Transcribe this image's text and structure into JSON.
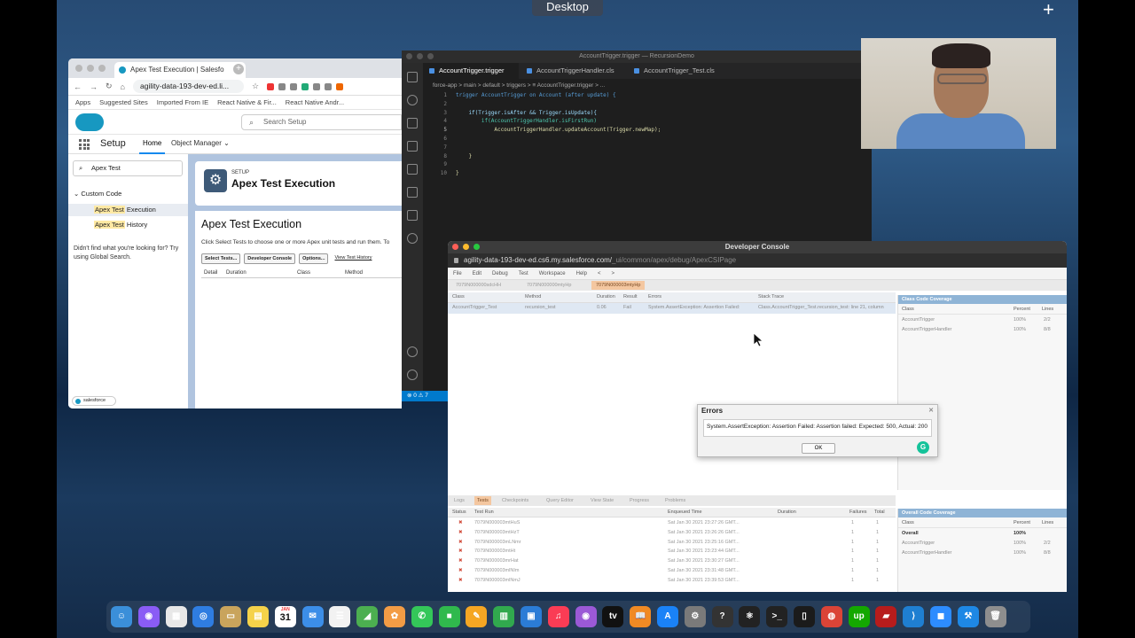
{
  "desktop": {
    "label": "Desktop"
  },
  "browser": {
    "tab_title": "Apex Test Execution | Salesfo",
    "url": "agility-data-193-dev-ed.li...",
    "bookmarks": [
      "Apps",
      "Suggested Sites",
      "Imported From IE",
      "React Native & Fir...",
      "React Native Andr..."
    ]
  },
  "salesforce": {
    "search_placeholder": "Search Setup",
    "app_name": "Setup",
    "nav": {
      "home": "Home",
      "object_manager": "Object Manager"
    },
    "quickfind_value": "Apex Test",
    "sidebar": {
      "group": "Custom Code",
      "items": [
        {
          "prefix": "Apex Test",
          "suffix": " Execution"
        },
        {
          "prefix": "Apex Test",
          "suffix": " History"
        }
      ],
      "not_found": "Didn't find what you're looking for? Try using Global Search."
    },
    "header": {
      "eyebrow": "SETUP",
      "title": "Apex Test Execution"
    },
    "main": {
      "title": "Apex Test Execution",
      "description": "Click Select Tests to choose one or more Apex unit tests and run them. To",
      "buttons": [
        "Select Tests...",
        "Developer Console",
        "Options..."
      ],
      "link": "View Test History",
      "columns": [
        "Detail",
        "Duration",
        "Class",
        "Method"
      ]
    },
    "salesforce_badge": "salesforce"
  },
  "vscode": {
    "title": "AccountTrigger.trigger — RecursionDemo",
    "tabs": [
      "AccountTrigger.trigger",
      "AccountTriggerHandler.cls",
      "AccountTrigger_Test.cls"
    ],
    "breadcrumb": "force-app > main > default > triggers > ≡ AccountTrigger.trigger > ...",
    "code": [
      {
        "n": "1",
        "t": "trigger AccountTrigger on Account (after update) {"
      },
      {
        "n": "2",
        "t": ""
      },
      {
        "n": "3",
        "t": "    if(Trigger.isAfter && Trigger.isUpdate){"
      },
      {
        "n": "4",
        "t": "        if(AccountTriggerHandler.isFirstRun)"
      },
      {
        "n": "5",
        "t": "            AccountTriggerHandler.updateAccount(Trigger.newMap);"
      },
      {
        "n": "6",
        "t": ""
      },
      {
        "n": "7",
        "t": ""
      },
      {
        "n": "8",
        "t": "    }"
      },
      {
        "n": "9",
        "t": ""
      },
      {
        "n": "10",
        "t": "}"
      }
    ],
    "status": "⊗ 0 ⚠ 7"
  },
  "devconsole": {
    "title": "Developer Console",
    "url_main": "agility-data-193-dev-ed.cs6.my.salesforce.com/",
    "url_path": "_ui/common/apex/debug/ApexCSIPage",
    "menu": [
      "File",
      "Edit",
      "Debug",
      "Test",
      "Workspace",
      "Help",
      "<",
      ">"
    ],
    "file_tabs": [
      "7079N000000sdcHH",
      "7079N000000mtyHp",
      "7079N000003mtyHp"
    ],
    "results_columns": [
      "Class",
      "Method",
      "Duration",
      "Result",
      "Errors",
      "Stack Trace"
    ],
    "results_row": {
      "class": "AccountTrigger_Test",
      "method": "recursion_test",
      "duration": "0.06",
      "result": "Fail",
      "errors": "System.AssertException: Assertion Failed:",
      "stack": "Class.AccountTrigger_Test.recursion_test: line 21, column"
    },
    "class_coverage": {
      "title": "Class Code Coverage",
      "columns": [
        "Class",
        "Percent",
        "Lines"
      ],
      "rows": [
        {
          "class": "AccountTrigger",
          "percent": "100%",
          "lines": "2/2"
        },
        {
          "class": "AccountTriggerHandler",
          "percent": "100%",
          "lines": "8/8"
        }
      ]
    },
    "bottom_tabs": [
      "Logs",
      "Tests",
      "Checkpoints",
      "Query Editor",
      "View State",
      "Progress",
      "Problems"
    ],
    "test_columns": [
      "Status",
      "Test Run",
      "Enqueued Time",
      "Duration",
      "Failures",
      "Total"
    ],
    "test_runs": [
      {
        "run": "7079N000003mtHuS",
        "time": "Sat Jan 30 2021 23:27:26 GMT...",
        "failures": "1",
        "total": "1"
      },
      {
        "run": "7079N000003mtHzT",
        "time": "Sat Jan 30 2021 23:26:26 GMT...",
        "failures": "1",
        "total": "1"
      },
      {
        "run": "7079N000003mLNmr",
        "time": "Sat Jan 30 2021 23:25:16 GMT...",
        "failures": "1",
        "total": "1"
      },
      {
        "run": "7079N000003mtHt",
        "time": "Sat Jan 30 2021 23:23:44 GMT...",
        "failures": "1",
        "total": "1"
      },
      {
        "run": "7079N000003mrHat",
        "time": "Sat Jan 30 2021 23:30:27 GMT...",
        "failures": "1",
        "total": "1"
      },
      {
        "run": "7079N000003mlNIm",
        "time": "Sat Jan 30 2021 23:31:48 GMT...",
        "failures": "1",
        "total": "1"
      },
      {
        "run": "7079N000003mlNmJ",
        "time": "Sat Jan 30 2021 23:39:53 GMT...",
        "failures": "1",
        "total": "1"
      }
    ],
    "overall_coverage": {
      "title": "Overall Code Coverage",
      "columns": [
        "Class",
        "Percent",
        "Lines"
      ],
      "rows": [
        {
          "class": "Overall",
          "percent": "100%",
          "lines": ""
        },
        {
          "class": "AccountTrigger",
          "percent": "100%",
          "lines": "2/2"
        },
        {
          "class": "AccountTriggerHandler",
          "percent": "100%",
          "lines": "8/8"
        }
      ]
    }
  },
  "error_dialog": {
    "title": "Errors",
    "message": "System.AssertException: Assertion Failed: Assertion failed: Expected: 500, Actual: 200",
    "ok": "OK"
  },
  "dock": {
    "calendar_day": "31",
    "calendar_month": "JAN",
    "apps": [
      "finder-icon",
      "siri-icon",
      "launchpad-icon",
      "safari-icon",
      "notes-icon",
      "stickies-icon",
      "calendar-icon",
      "mail-icon",
      "reminders-icon",
      "maps-icon",
      "photos-icon",
      "messages-icon",
      "facetime-icon",
      "pages-icon",
      "numbers-icon",
      "keynote-icon",
      "music-icon",
      "podcasts-icon",
      "tv-icon",
      "books-icon",
      "appstore-icon",
      "preferences-icon",
      "help-icon",
      "react-icon",
      "terminal-icon",
      "activity-icon",
      "chrome-icon",
      "upwork-icon",
      "rar-icon",
      "vscode-icon",
      "zoom-icon",
      "xcode-icon",
      "trash-icon"
    ]
  }
}
